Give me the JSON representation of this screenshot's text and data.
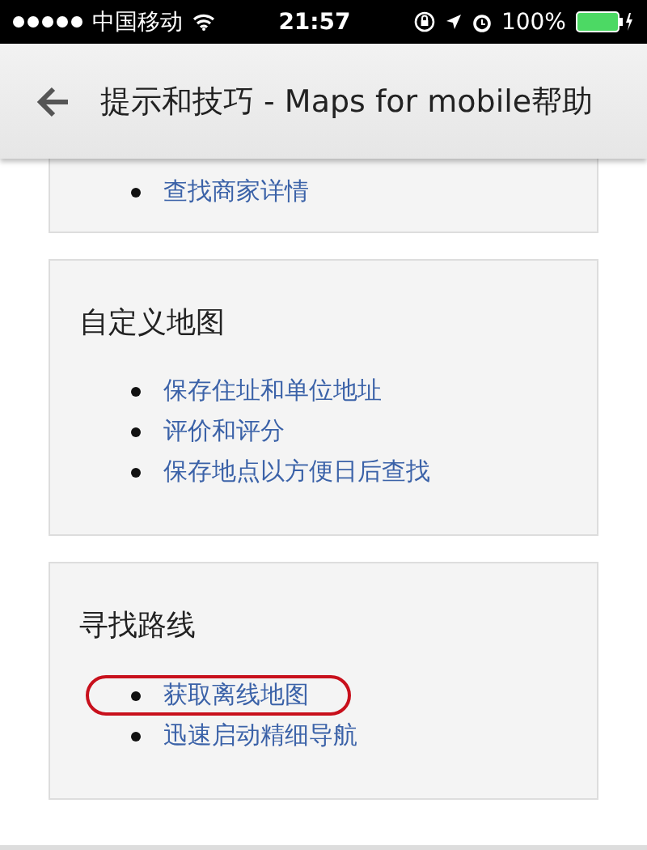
{
  "status_bar": {
    "carrier": "中国移动",
    "time": "21:57",
    "battery": "100%"
  },
  "header": {
    "title": "提示和技巧 - Maps for mobile帮助"
  },
  "sections": [
    {
      "items": [
        {
          "label": "查找商家详情",
          "highlighted": false
        }
      ]
    },
    {
      "title": "自定义地图",
      "items": [
        {
          "label": "保存住址和单位地址",
          "highlighted": false
        },
        {
          "label": "评价和评分",
          "highlighted": false
        },
        {
          "label": "保存地点以方便日后查找",
          "highlighted": false
        }
      ]
    },
    {
      "title": "寻找路线",
      "items": [
        {
          "label": "获取离线地图",
          "highlighted": true
        },
        {
          "label": "迅速启动精细导航",
          "highlighted": false
        }
      ]
    }
  ]
}
